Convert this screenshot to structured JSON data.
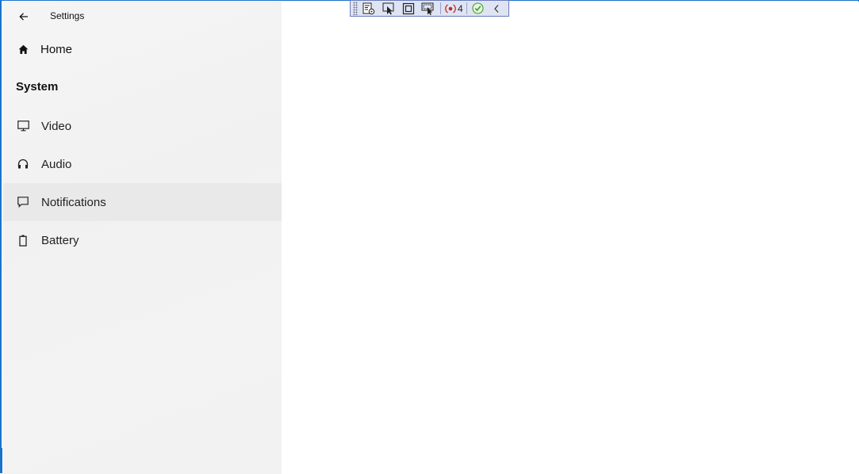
{
  "window": {
    "title": "Settings",
    "accent_color": "#1a73c9"
  },
  "nav": {
    "back_icon": "back-arrow-icon",
    "home": {
      "label": "Home",
      "icon": "home-icon"
    },
    "section_heading": "System",
    "items": [
      {
        "label": "Video",
        "icon": "monitor-icon",
        "selected": false
      },
      {
        "label": "Audio",
        "icon": "headphones-icon",
        "selected": false
      },
      {
        "label": "Notifications",
        "icon": "message-icon",
        "selected": true
      },
      {
        "label": "Battery",
        "icon": "battery-icon",
        "selected": false
      }
    ]
  },
  "debug_toolbar": {
    "buttons": [
      "live-visual-tree-icon",
      "select-element-icon",
      "display-layout-adorners-icon",
      "track-focused-element-icon"
    ],
    "binding_failures_count": "4",
    "hot_reload_status_icon": "check-icon",
    "collapse_icon": "chevron-left-icon"
  }
}
